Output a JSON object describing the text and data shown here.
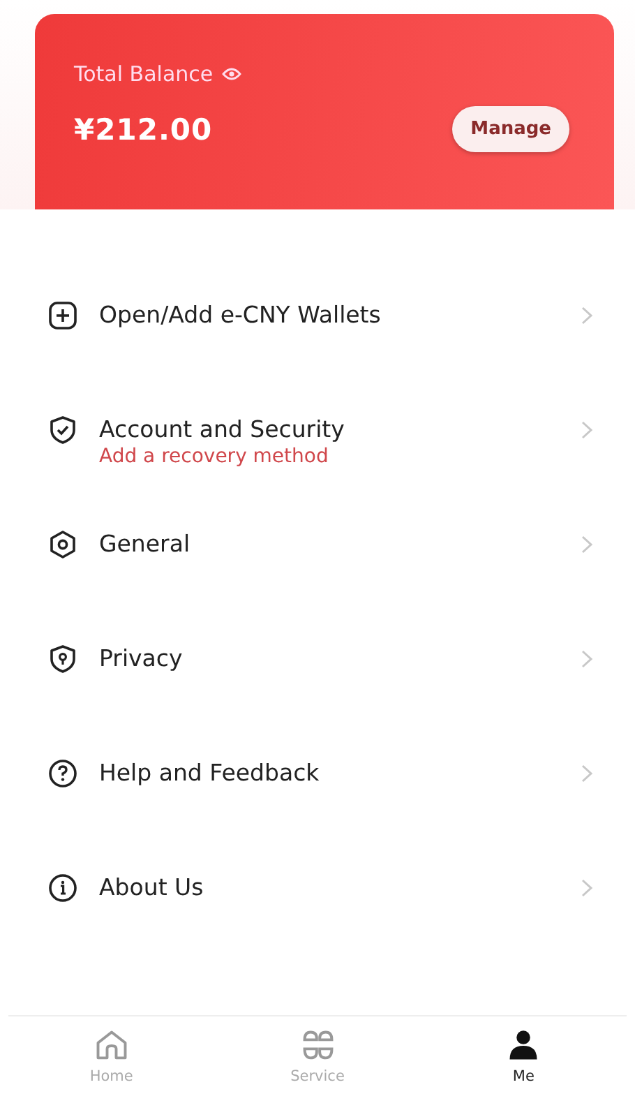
{
  "balance_card": {
    "label": "Total Balance",
    "amount": "¥212.00",
    "button": "Manage"
  },
  "menu": [
    {
      "label": "Open/Add e-CNY Wallets"
    },
    {
      "label": "Account and Security",
      "note": "Add a recovery method"
    },
    {
      "label": "General"
    },
    {
      "label": "Privacy"
    },
    {
      "label": "Help and Feedback"
    },
    {
      "label": "About Us"
    }
  ],
  "tab_bar": [
    {
      "label": "Home",
      "selected": false
    },
    {
      "label": "Service",
      "selected": false
    },
    {
      "label": "Me",
      "selected": true
    }
  ]
}
